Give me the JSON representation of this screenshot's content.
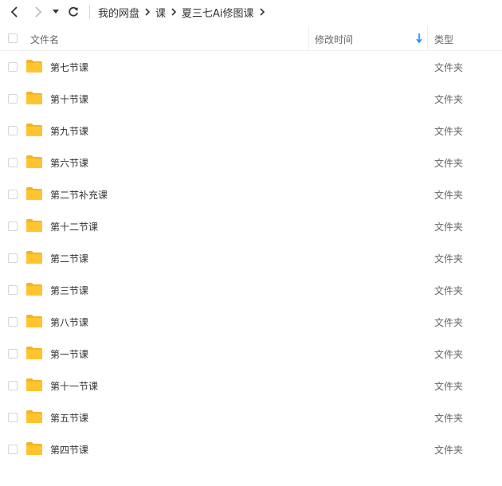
{
  "breadcrumb": [
    "我的网盘",
    "课",
    "夏三七Ai修图课"
  ],
  "columns": {
    "name": "文件名",
    "modified": "修改时间",
    "type": "类型"
  },
  "colors": {
    "folder": "#ffc531",
    "folder_back": "#f5b41f",
    "sort_arrow": "#1a8cff"
  },
  "files": [
    {
      "name": "第七节课",
      "type": "文件夹"
    },
    {
      "name": "第十节课",
      "type": "文件夹"
    },
    {
      "name": "第九节课",
      "type": "文件夹"
    },
    {
      "name": "第六节课",
      "type": "文件夹"
    },
    {
      "name": "第二节补充课",
      "type": "文件夹"
    },
    {
      "name": "第十二节课",
      "type": "文件夹"
    },
    {
      "name": "第二节课",
      "type": "文件夹"
    },
    {
      "name": "第三节课",
      "type": "文件夹"
    },
    {
      "name": "第八节课",
      "type": "文件夹"
    },
    {
      "name": "第一节课",
      "type": "文件夹"
    },
    {
      "name": "第十一节课",
      "type": "文件夹"
    },
    {
      "name": "第五节课",
      "type": "文件夹"
    },
    {
      "name": "第四节课",
      "type": "文件夹"
    }
  ]
}
